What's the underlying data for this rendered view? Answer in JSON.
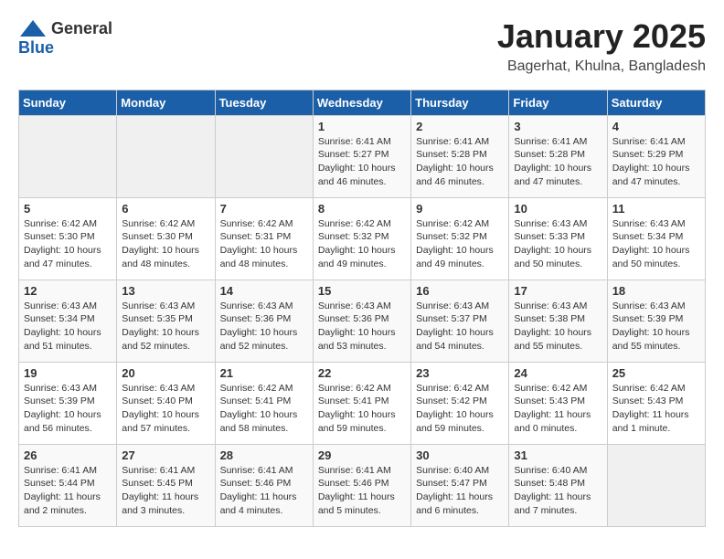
{
  "logo": {
    "general": "General",
    "blue": "Blue"
  },
  "title": "January 2025",
  "subtitle": "Bagerhat, Khulna, Bangladesh",
  "days_of_week": [
    "Sunday",
    "Monday",
    "Tuesday",
    "Wednesday",
    "Thursday",
    "Friday",
    "Saturday"
  ],
  "weeks": [
    [
      {
        "num": "",
        "info": ""
      },
      {
        "num": "",
        "info": ""
      },
      {
        "num": "",
        "info": ""
      },
      {
        "num": "1",
        "info": "Sunrise: 6:41 AM\nSunset: 5:27 PM\nDaylight: 10 hours\nand 46 minutes."
      },
      {
        "num": "2",
        "info": "Sunrise: 6:41 AM\nSunset: 5:28 PM\nDaylight: 10 hours\nand 46 minutes."
      },
      {
        "num": "3",
        "info": "Sunrise: 6:41 AM\nSunset: 5:28 PM\nDaylight: 10 hours\nand 47 minutes."
      },
      {
        "num": "4",
        "info": "Sunrise: 6:41 AM\nSunset: 5:29 PM\nDaylight: 10 hours\nand 47 minutes."
      }
    ],
    [
      {
        "num": "5",
        "info": "Sunrise: 6:42 AM\nSunset: 5:30 PM\nDaylight: 10 hours\nand 47 minutes."
      },
      {
        "num": "6",
        "info": "Sunrise: 6:42 AM\nSunset: 5:30 PM\nDaylight: 10 hours\nand 48 minutes."
      },
      {
        "num": "7",
        "info": "Sunrise: 6:42 AM\nSunset: 5:31 PM\nDaylight: 10 hours\nand 48 minutes."
      },
      {
        "num": "8",
        "info": "Sunrise: 6:42 AM\nSunset: 5:32 PM\nDaylight: 10 hours\nand 49 minutes."
      },
      {
        "num": "9",
        "info": "Sunrise: 6:42 AM\nSunset: 5:32 PM\nDaylight: 10 hours\nand 49 minutes."
      },
      {
        "num": "10",
        "info": "Sunrise: 6:43 AM\nSunset: 5:33 PM\nDaylight: 10 hours\nand 50 minutes."
      },
      {
        "num": "11",
        "info": "Sunrise: 6:43 AM\nSunset: 5:34 PM\nDaylight: 10 hours\nand 50 minutes."
      }
    ],
    [
      {
        "num": "12",
        "info": "Sunrise: 6:43 AM\nSunset: 5:34 PM\nDaylight: 10 hours\nand 51 minutes."
      },
      {
        "num": "13",
        "info": "Sunrise: 6:43 AM\nSunset: 5:35 PM\nDaylight: 10 hours\nand 52 minutes."
      },
      {
        "num": "14",
        "info": "Sunrise: 6:43 AM\nSunset: 5:36 PM\nDaylight: 10 hours\nand 52 minutes."
      },
      {
        "num": "15",
        "info": "Sunrise: 6:43 AM\nSunset: 5:36 PM\nDaylight: 10 hours\nand 53 minutes."
      },
      {
        "num": "16",
        "info": "Sunrise: 6:43 AM\nSunset: 5:37 PM\nDaylight: 10 hours\nand 54 minutes."
      },
      {
        "num": "17",
        "info": "Sunrise: 6:43 AM\nSunset: 5:38 PM\nDaylight: 10 hours\nand 55 minutes."
      },
      {
        "num": "18",
        "info": "Sunrise: 6:43 AM\nSunset: 5:39 PM\nDaylight: 10 hours\nand 55 minutes."
      }
    ],
    [
      {
        "num": "19",
        "info": "Sunrise: 6:43 AM\nSunset: 5:39 PM\nDaylight: 10 hours\nand 56 minutes."
      },
      {
        "num": "20",
        "info": "Sunrise: 6:43 AM\nSunset: 5:40 PM\nDaylight: 10 hours\nand 57 minutes."
      },
      {
        "num": "21",
        "info": "Sunrise: 6:42 AM\nSunset: 5:41 PM\nDaylight: 10 hours\nand 58 minutes."
      },
      {
        "num": "22",
        "info": "Sunrise: 6:42 AM\nSunset: 5:41 PM\nDaylight: 10 hours\nand 59 minutes."
      },
      {
        "num": "23",
        "info": "Sunrise: 6:42 AM\nSunset: 5:42 PM\nDaylight: 10 hours\nand 59 minutes."
      },
      {
        "num": "24",
        "info": "Sunrise: 6:42 AM\nSunset: 5:43 PM\nDaylight: 11 hours\nand 0 minutes."
      },
      {
        "num": "25",
        "info": "Sunrise: 6:42 AM\nSunset: 5:43 PM\nDaylight: 11 hours\nand 1 minute."
      }
    ],
    [
      {
        "num": "26",
        "info": "Sunrise: 6:41 AM\nSunset: 5:44 PM\nDaylight: 11 hours\nand 2 minutes."
      },
      {
        "num": "27",
        "info": "Sunrise: 6:41 AM\nSunset: 5:45 PM\nDaylight: 11 hours\nand 3 minutes."
      },
      {
        "num": "28",
        "info": "Sunrise: 6:41 AM\nSunset: 5:46 PM\nDaylight: 11 hours\nand 4 minutes."
      },
      {
        "num": "29",
        "info": "Sunrise: 6:41 AM\nSunset: 5:46 PM\nDaylight: 11 hours\nand 5 minutes."
      },
      {
        "num": "30",
        "info": "Sunrise: 6:40 AM\nSunset: 5:47 PM\nDaylight: 11 hours\nand 6 minutes."
      },
      {
        "num": "31",
        "info": "Sunrise: 6:40 AM\nSunset: 5:48 PM\nDaylight: 11 hours\nand 7 minutes."
      },
      {
        "num": "",
        "info": ""
      }
    ]
  ]
}
